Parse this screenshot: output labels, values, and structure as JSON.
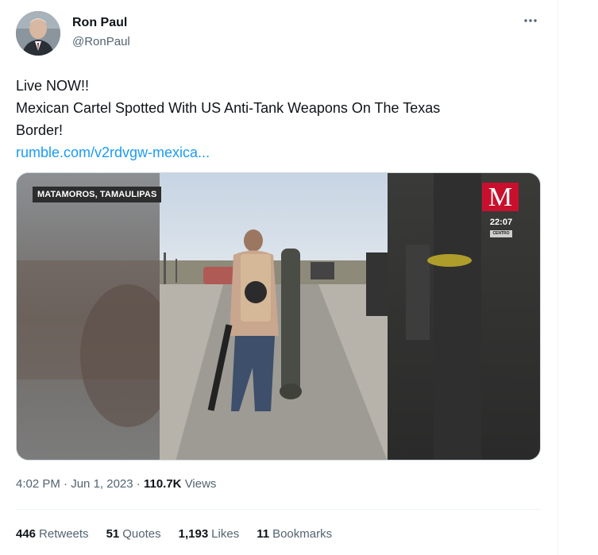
{
  "author": {
    "name": "Ron Paul",
    "handle": "@RonPaul"
  },
  "more_icon": "more-horizontal-icon",
  "tweet": {
    "line1": "Live NOW!!",
    "line2": "Mexican Cartel Spotted With US Anti-Tank Weapons On The Texas",
    "line3": "Border!",
    "link": "rumble.com/v2rdvgw-mexica..."
  },
  "media": {
    "location_label": "MATAMOROS, TAMAULIPAS",
    "brand_letter": "M",
    "clock": "22:07",
    "clock_sub": "CENTRO"
  },
  "meta": {
    "time": "4:02 PM",
    "date": "Jun 1, 2023",
    "views_count": "110.7K",
    "views_label": "Views"
  },
  "stats": {
    "retweets_count": "446",
    "retweets_label": "Retweets",
    "quotes_count": "51",
    "quotes_label": "Quotes",
    "likes_count": "1,193",
    "likes_label": "Likes",
    "bookmarks_count": "11",
    "bookmarks_label": "Bookmarks"
  },
  "colors": {
    "link": "#1d9bf0",
    "secondary_text": "#536471",
    "brand_red": "#c8102e"
  }
}
